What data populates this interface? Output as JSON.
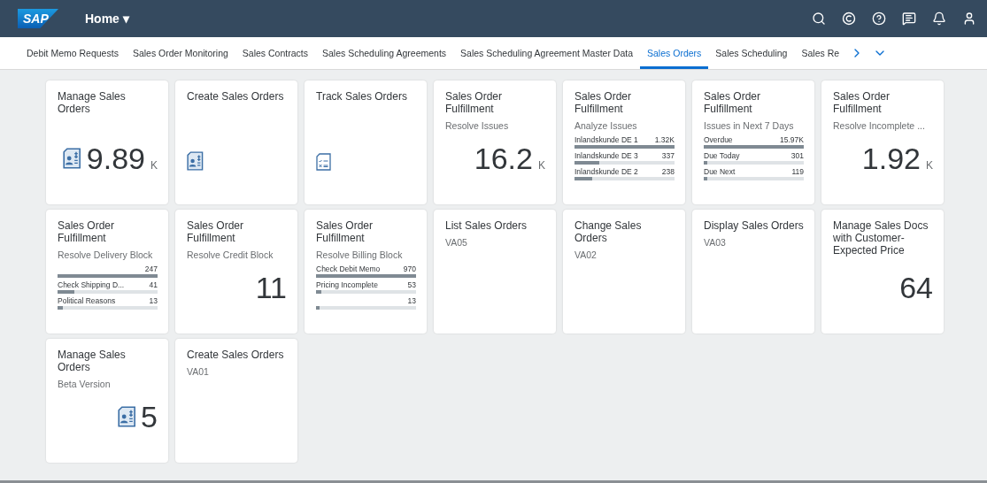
{
  "shell": {
    "logo": "SAP",
    "title": "Home ▾"
  },
  "tabs": [
    {
      "label": "Debit Memo Requests",
      "selected": false
    },
    {
      "label": "Sales Order Monitoring",
      "selected": false
    },
    {
      "label": "Sales Contracts",
      "selected": false
    },
    {
      "label": "Sales Scheduling Agreements",
      "selected": false
    },
    {
      "label": "Sales Scheduling Agreement Master Data",
      "selected": false
    },
    {
      "label": "Sales Orders",
      "selected": true
    },
    {
      "label": "Sales Scheduling",
      "selected": false
    },
    {
      "label": "Sales Re",
      "selected": false
    }
  ],
  "tiles": [
    {
      "kind": "kpi-order",
      "title": "Manage Sales Orders",
      "value": "9.89",
      "unit": "K"
    },
    {
      "kind": "order-app",
      "title": "Create Sales Orders"
    },
    {
      "kind": "checklist-app",
      "title": "Track Sales Orders"
    },
    {
      "kind": "kpi",
      "title": "Sales Order Fulfillment",
      "subtitle": "Resolve Issues",
      "value": "16.2",
      "unit": "K"
    },
    {
      "kind": "comparison",
      "title": "Sales Order Fulfillment",
      "subtitle": "Analyze Issues",
      "bars": [
        {
          "label": "Inlandskunde DE 1",
          "value": "1.32K",
          "level": 1
        },
        {
          "label": "Inlandskunde DE 3",
          "value": "337",
          "level": 0.25
        },
        {
          "label": "Inlandskunde DE 2",
          "value": "238",
          "level": 0.18
        }
      ]
    },
    {
      "kind": "comparison",
      "title": "Sales Order Fulfillment",
      "subtitle": "Issues in Next 7 Days",
      "bars": [
        {
          "label": "Overdue",
          "value": "15.97K",
          "level": 1
        },
        {
          "label": "Due Today",
          "value": "301",
          "level": 0.03
        },
        {
          "label": "Due Next",
          "value": "119",
          "level": 0.03
        }
      ]
    },
    {
      "kind": "kpi",
      "title": "Sales Order Fulfillment",
      "subtitle": "Resolve Incomplete ...",
      "value": "1.92",
      "unit": "K"
    },
    {
      "kind": "comparison",
      "title": "Sales Order Fulfillment",
      "subtitle": "Resolve Delivery Block",
      "bars": [
        {
          "value": "247",
          "level": 1
        },
        {
          "label": "Check Shipping D...",
          "value": "41",
          "level": 0.17
        },
        {
          "label": "Political Reasons",
          "value": "13",
          "level": 0.05
        }
      ]
    },
    {
      "kind": "kpi",
      "title": "Sales Order Fulfillment",
      "subtitle": "Resolve Credit Block",
      "value": "11"
    },
    {
      "kind": "comparison",
      "title": "Sales Order Fulfillment",
      "subtitle": "Resolve Billing Block",
      "bars": [
        {
          "label": "Check Debit Memo",
          "value": "970",
          "level": 1
        },
        {
          "label": "Pricing Incomplete",
          "value": "53",
          "level": 0.05
        },
        {
          "value": "13",
          "level": 0.02
        }
      ]
    },
    {
      "kind": "launch",
      "title": "List Sales Orders",
      "subtitle": "VA05"
    },
    {
      "kind": "launch",
      "title": "Change Sales Orders",
      "subtitle": "VA02"
    },
    {
      "kind": "launch",
      "title": "Display Sales Orders",
      "subtitle": "VA03"
    },
    {
      "kind": "kpi",
      "title": "Manage Sales Docs with Customer-Expected Price",
      "value": "64"
    },
    {
      "kind": "kpi-order",
      "title": "Manage Sales Orders",
      "subtitle": "Beta Version",
      "value": "5"
    },
    {
      "kind": "launch",
      "title": "Create Sales Orders",
      "subtitle": "VA01"
    }
  ]
}
